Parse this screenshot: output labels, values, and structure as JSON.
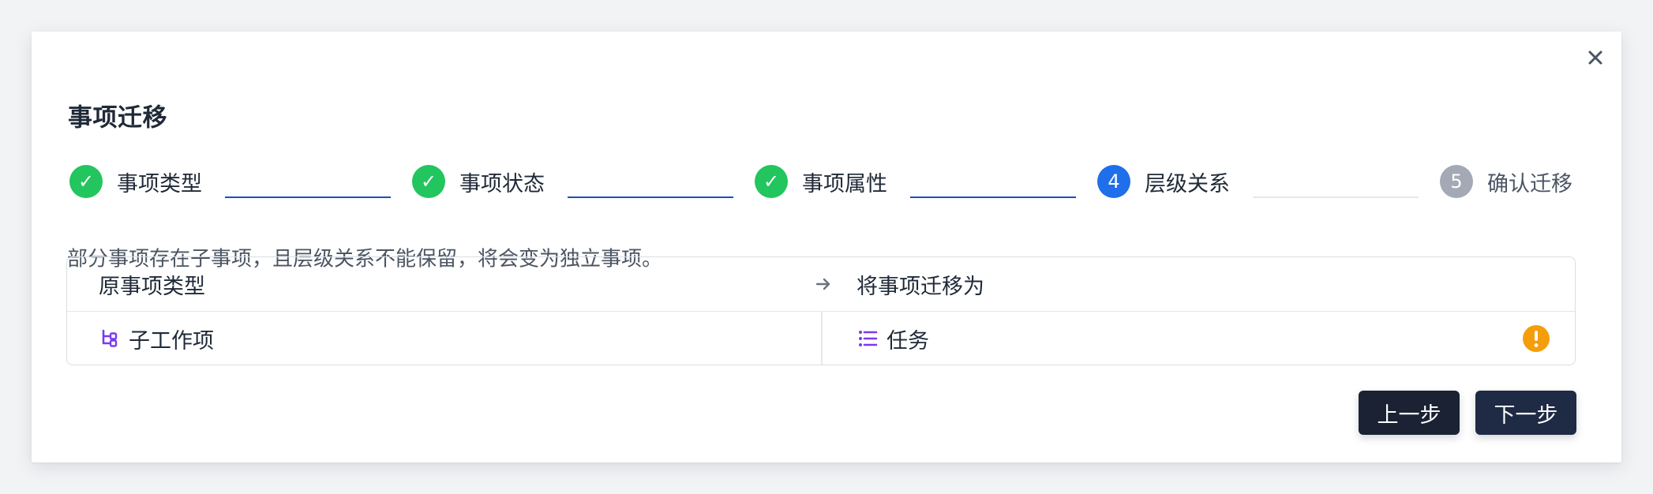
{
  "dialog": {
    "title": "事项迁移",
    "close_icon": "close-icon"
  },
  "steps": [
    {
      "label": "事项类型",
      "status": "done",
      "marker": "✓"
    },
    {
      "label": "事项状态",
      "status": "done",
      "marker": "✓"
    },
    {
      "label": "事项属性",
      "status": "done",
      "marker": "✓"
    },
    {
      "label": "层级关系",
      "status": "active",
      "marker": "4"
    },
    {
      "label": "确认迁移",
      "status": "pending",
      "marker": "5"
    }
  ],
  "notice": "部分事项存在子事项，且层级关系不能保留，将会变为独立事项。",
  "table": {
    "header_left": "原事项类型",
    "header_right": "将事项迁移为",
    "arrow_icon": "arrow-right-icon",
    "rows": [
      {
        "source_type": "子工作项",
        "source_icon": "subtask-icon",
        "target_type": "任务",
        "target_icon": "list-icon",
        "status_icon": "warning-icon"
      }
    ]
  },
  "buttons": {
    "prev": "上一步",
    "next": "下一步"
  },
  "colors": {
    "success": "#22c55e",
    "active": "#1f6feb",
    "pending": "#a3a9b5",
    "connector_done": "#1e4fb8",
    "warning": "#f59e0b",
    "type_icon": "#7c3aed",
    "button": "#1a2233"
  }
}
